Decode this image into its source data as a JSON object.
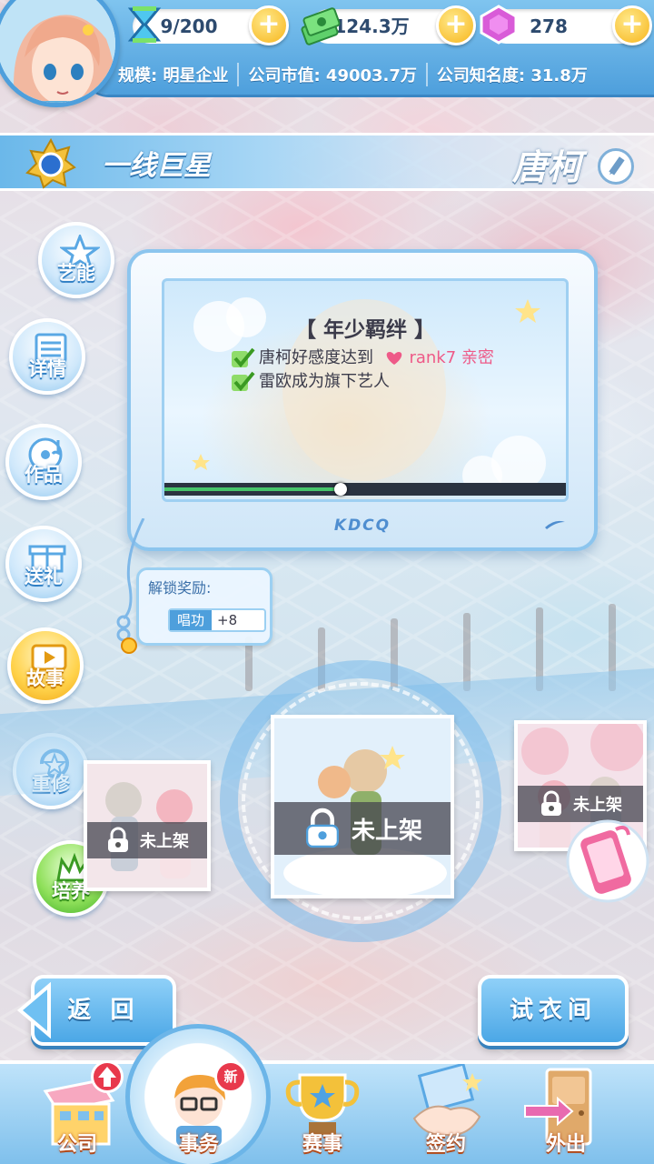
{
  "resources": {
    "stamina": "9/200",
    "cash": "124.3万",
    "gems": "278"
  },
  "stats": {
    "scale": "规模: 明星企业",
    "market_value": "公司市值: 49003.7万",
    "fame": "公司知名度: 31.8万"
  },
  "header": {
    "rank_title": "一线巨星",
    "artist_name": "唐柯"
  },
  "side_menu": [
    {
      "label": "艺能",
      "icon": "star-icon"
    },
    {
      "label": "详情",
      "icon": "list-icon"
    },
    {
      "label": "作品",
      "icon": "disc-icon"
    },
    {
      "label": "送礼",
      "icon": "gift-icon"
    },
    {
      "label": "故事",
      "icon": "play-icon"
    },
    {
      "label": "重修",
      "icon": "refresh-star-icon"
    },
    {
      "label": "培养",
      "icon": "crown-icon"
    }
  ],
  "story": {
    "title": "【 年少羁绊 】",
    "cond1_prefix": "唐柯好感度达到",
    "cond1_rank": "rank7 亲密",
    "cond2": "雷欧成为旗下艺人",
    "progress": 0.44,
    "brand": "KDCQ"
  },
  "reward": {
    "title": "解锁奖励:",
    "stat": "唱功",
    "amount": "+8"
  },
  "cards": [
    {
      "status": "未上架"
    },
    {
      "status": "未上架"
    },
    {
      "status": "未上架"
    }
  ],
  "buttons": {
    "back": "返 回",
    "wardrobe": "试衣间"
  },
  "nav": [
    {
      "label": "公司",
      "icon": "company-building-icon"
    },
    {
      "label": "事务",
      "icon": "manager-icon",
      "badge": "新"
    },
    {
      "label": "赛事",
      "icon": "trophy-icon"
    },
    {
      "label": "签约",
      "icon": "handshake-icon"
    },
    {
      "label": "外出",
      "icon": "door-icon"
    }
  ],
  "colors": {
    "accent": "#4e9fdc",
    "gold": "#f7b51c",
    "pink": "#ee5a88"
  }
}
